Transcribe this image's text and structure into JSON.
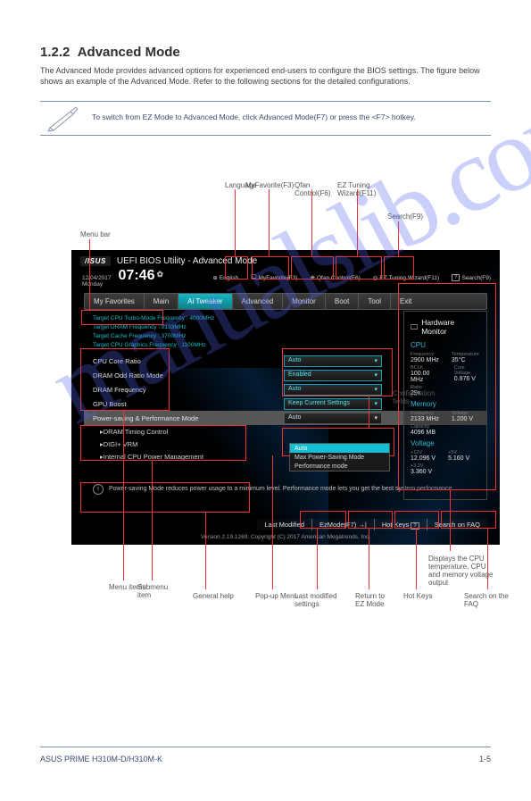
{
  "section": {
    "number": "1.2.2",
    "title": "Advanced Mode"
  },
  "intro_para": "The Advanced Mode provides advanced options for experienced end-users to configure the BIOS settings. The figure below shows an example of the Advanced Mode. Refer to the following sections for the detailed configurations.",
  "note_text": "To switch from EZ Mode to Advanced Mode, click Advanced Mode(F7) or press the <F7> hotkey.",
  "callout_labels": {
    "menu_bar": "Menu bar",
    "language": "Language",
    "myfav": "MyFavorite(F3)",
    "qfan": "Qfan Control(F6)",
    "eztune": "EZ Tuning Wizard(F11)",
    "search": "Search(F9)",
    "hot_keys": "Hot Keys",
    "config_fields": "Configuration fields",
    "menu_items": "Menu items",
    "submenu": "Submenu item",
    "general_help": "General help",
    "popup": "Pop-up Menu",
    "last_modified": "Last modified settings",
    "return_ez": "Return to EZ Mode",
    "hw_info": "Displays the CPU temperature, CPU and memory voltage output",
    "search_faq": "Search on the FAQ"
  },
  "bios": {
    "brand": "/ISUS",
    "title": "UEFI BIOS Utility - Advanced Mode",
    "date": "12/04/2017",
    "day": "Monday",
    "time": "07:46",
    "topbar": {
      "english": "English",
      "myfav": "MyFavorite(F3)",
      "qfan": "Qfan Control(F6)",
      "ez": "EZ Tuning Wizard(F11)",
      "search": "Search(F9)"
    },
    "menu": [
      "My Favorites",
      "Main",
      "Ai Tweaker",
      "Advanced",
      "Monitor",
      "Boot",
      "Tool",
      "Exit"
    ],
    "targets": [
      "Target CPU Turbo-Mode Frequency : 4000MHz",
      "Target DRAM Frequency : 2133MHz",
      "Target Cache Frequency : 3700MHz",
      "Target CPU Graphics Frequency : 1100MHz"
    ],
    "rows": [
      {
        "label": "CPU Core Ratio",
        "value": "Auto"
      },
      {
        "label": "DRAM Odd Ratio Mode",
        "value": "Enabled"
      },
      {
        "label": "DRAM Frequency",
        "value": "Auto"
      },
      {
        "label": "GPU Boost",
        "value": "Keep Current Settings"
      },
      {
        "label": "Power-saving & Performance Mode",
        "value": "Auto"
      }
    ],
    "subitems": [
      "DRAM Timing Control",
      "DIGI+ VRM",
      "Internal CPU Power Management"
    ],
    "popup": [
      "Auto",
      "Max Power-Saving Mode",
      "Performance mode"
    ],
    "info": "Power-saving Mode reduces power usage to a minimum level. Performance mode lets you get the best system performance.",
    "hw": {
      "title": "Hardware Monitor",
      "cpu": {
        "title": "CPU",
        "freq_l": "Frequency",
        "freq": "2900 MHz",
        "temp_l": "Temperature",
        "temp": "35°C",
        "bclk_l": "BCLK",
        "bclk": "100.00 MHz",
        "vcore_l": "Core Voltage",
        "vcore": "0.976 V",
        "ratio_l": "Ratio",
        "ratio": "29x"
      },
      "mem": {
        "title": "Memory",
        "freq_l": "Frequency",
        "freq": "2133 MHz",
        "volt_l": "Voltage",
        "volt": "1.200 V",
        "cap_l": "Capacity",
        "cap": "4096 MB"
      },
      "volt": {
        "title": "Voltage",
        "v12_l": "+12V",
        "v12": "12.096 V",
        "v5_l": "+5V",
        "v5": "5.160 V",
        "v33_l": "+3.3V",
        "v33": "3.360 V"
      }
    },
    "bottom": {
      "last": "Last Modified",
      "ez": "EzMode(F7)",
      "hk": "Hot Keys",
      "faq": "Search on FAQ"
    },
    "footer": "Version 2.19.1269. Copyright (C) 2017 American Megatrends, Inc."
  },
  "page_footer": {
    "left": "ASUS PRIME H310M-D/H310M-K",
    "right": "1-5"
  },
  "watermark": "manualslib.com"
}
